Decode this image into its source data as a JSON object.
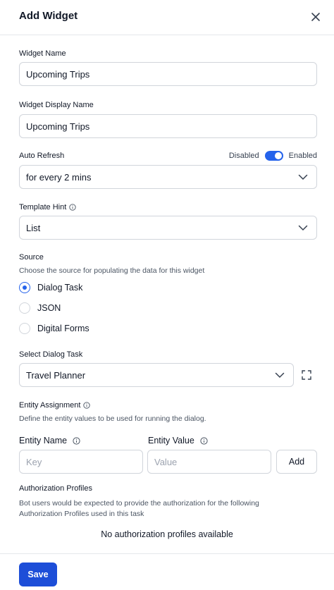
{
  "dialog": {
    "title": "Add Widget",
    "close_icon": "close-icon"
  },
  "widget_name": {
    "label": "Widget Name",
    "value": "Upcoming Trips"
  },
  "widget_display_name": {
    "label": "Widget Display Name",
    "value": "Upcoming Trips"
  },
  "auto_refresh": {
    "label": "Auto Refresh",
    "toggle_off_label": "Disabled",
    "toggle_on_label": "Enabled",
    "enabled": true,
    "selected": "for every 2 mins"
  },
  "template_hint": {
    "label": "Template Hint",
    "selected": "List"
  },
  "source": {
    "label": "Source",
    "description": "Choose the source for populating the data for this widget",
    "options": [
      {
        "label": "Dialog Task",
        "checked": true
      },
      {
        "label": "JSON",
        "checked": false
      },
      {
        "label": "Digital Forms",
        "checked": false
      }
    ]
  },
  "dialog_task": {
    "label": "Select Dialog Task",
    "selected": "Travel Planner"
  },
  "entity_assignment": {
    "label": "Entity Assignment",
    "description": "Define the entity values to be used for running the dialog.",
    "name_col": "Entity Name",
    "value_col": "Entity Value",
    "key_placeholder": "Key",
    "value_placeholder": "Value",
    "add_label": "Add"
  },
  "authorization": {
    "label": "Authorization Profiles",
    "description_line1": "Bot users would be expected to provide the authorization for the following",
    "description_line2": "Authorization Profiles used in this task",
    "empty_text": "No authorization profiles available"
  },
  "footer": {
    "save_label": "Save"
  },
  "colors": {
    "accent": "#2563eb",
    "save_button": "#1d4ed8",
    "border": "#d1d5db"
  }
}
